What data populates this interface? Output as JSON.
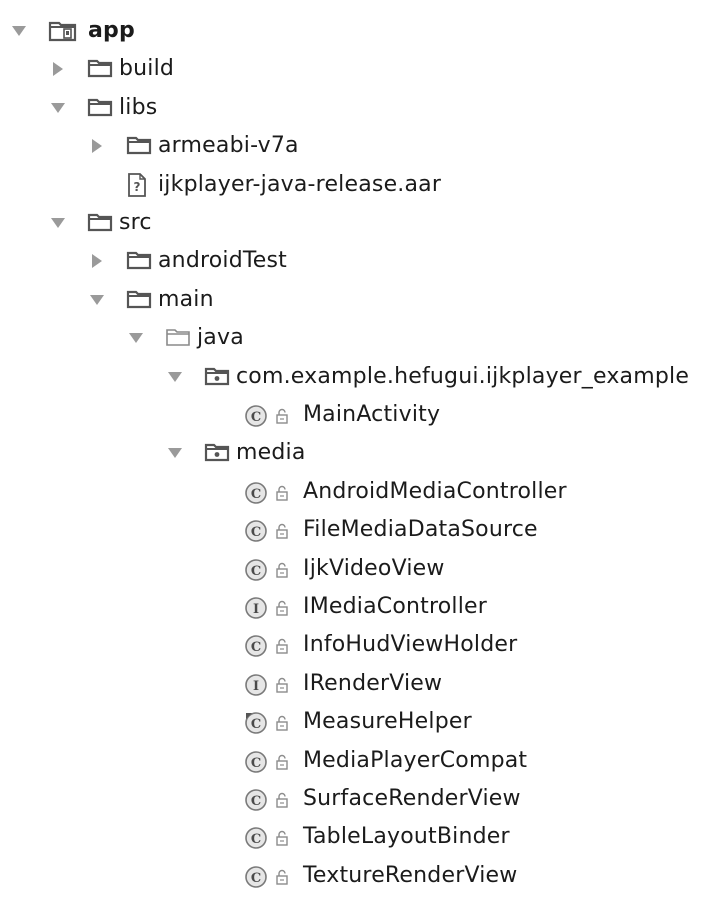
{
  "tree": [
    {
      "label": "app",
      "kind": "module",
      "depth": 0,
      "state": "expanded",
      "bold": true
    },
    {
      "label": "build",
      "kind": "folder",
      "depth": 1,
      "state": "collapsed"
    },
    {
      "label": "libs",
      "kind": "folder",
      "depth": 1,
      "state": "expanded"
    },
    {
      "label": "armeabi-v7a",
      "kind": "folder",
      "depth": 2,
      "state": "collapsed"
    },
    {
      "label": "ijkplayer-java-release.aar",
      "kind": "unknown-file",
      "depth": 2,
      "state": "none"
    },
    {
      "label": "src",
      "kind": "folder",
      "depth": 1,
      "state": "expanded"
    },
    {
      "label": "androidTest",
      "kind": "folder",
      "depth": 2,
      "state": "collapsed"
    },
    {
      "label": "main",
      "kind": "folder",
      "depth": 2,
      "state": "expanded"
    },
    {
      "label": "java",
      "kind": "source-folder",
      "depth": 3,
      "state": "expanded"
    },
    {
      "label": "com.example.hefugui.ijkplayer_example",
      "kind": "package",
      "depth": 4,
      "state": "expanded"
    },
    {
      "label": "MainActivity",
      "kind": "class",
      "depth": 5,
      "state": "none"
    },
    {
      "label": "media",
      "kind": "package",
      "depth": 4,
      "state": "expanded"
    },
    {
      "label": "AndroidMediaController",
      "kind": "class",
      "depth": 5,
      "state": "none"
    },
    {
      "label": "FileMediaDataSource",
      "kind": "class",
      "depth": 5,
      "state": "none"
    },
    {
      "label": "IjkVideoView",
      "kind": "class",
      "depth": 5,
      "state": "none"
    },
    {
      "label": "IMediaController",
      "kind": "interface",
      "depth": 5,
      "state": "none"
    },
    {
      "label": "InfoHudViewHolder",
      "kind": "class",
      "depth": 5,
      "state": "none"
    },
    {
      "label": "IRenderView",
      "kind": "interface",
      "depth": 5,
      "state": "none"
    },
    {
      "label": "MeasureHelper",
      "kind": "class-final",
      "depth": 5,
      "state": "none"
    },
    {
      "label": "MediaPlayerCompat",
      "kind": "class",
      "depth": 5,
      "state": "none"
    },
    {
      "label": "SurfaceRenderView",
      "kind": "class",
      "depth": 5,
      "state": "none"
    },
    {
      "label": "TableLayoutBinder",
      "kind": "class",
      "depth": 5,
      "state": "none"
    },
    {
      "label": "TextureRenderView",
      "kind": "class",
      "depth": 5,
      "state": "none"
    }
  ],
  "icons": {
    "module": "module-folder-icon",
    "folder": "folder-icon",
    "source-folder": "source-folder-icon",
    "package": "package-icon",
    "unknown-file": "unknown-file-icon",
    "class": "class-icon",
    "class-final": "class-icon",
    "interface": "interface-icon"
  },
  "colors": {
    "text": "#1b1b1b",
    "icon_stroke": "#555555",
    "arrow": "#9a9a9a",
    "badge_fill": "#e6e6e6"
  }
}
